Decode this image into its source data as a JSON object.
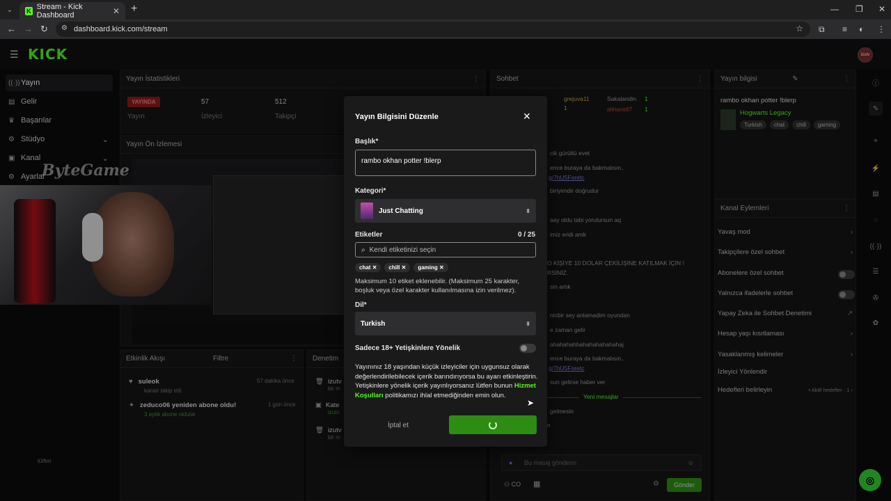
{
  "browser": {
    "tab_title": "Stream - Kick Dashboard",
    "url": "dashboard.kick.com/stream",
    "tab_close": "✕",
    "new_tab": "+"
  },
  "app": {
    "logo": "KICK",
    "avatar": "izutv"
  },
  "sidebar": {
    "items": [
      {
        "label": "Yayın",
        "icon": "broadcast-icon"
      },
      {
        "label": "Gelir",
        "icon": "wallet-icon"
      },
      {
        "label": "Başarılar",
        "icon": "trophy-icon"
      },
      {
        "label": "Stüdyo",
        "icon": "studio-icon"
      },
      {
        "label": "Kanal",
        "icon": "channel-icon"
      },
      {
        "label": "Ayarlar",
        "icon": "gear-icon"
      }
    ]
  },
  "stats": {
    "title": "Yayın İstatistikleri",
    "live_badge": "YAYINDA",
    "live_sub": "Yayın",
    "viewers_value": "57",
    "viewers_label": "İzleyici",
    "followers_value": "512",
    "followers_label": "Takipçi"
  },
  "preview": {
    "title": "Yayın Ön İzlemesi"
  },
  "watermark": "ByteGame",
  "activity": {
    "title": "Etkinlik Akışı",
    "filter": "Filtre",
    "items": [
      {
        "name": "suleok",
        "desc": "kanalı takip etti",
        "time": "57 dakika önce"
      },
      {
        "name": "zeduco06 yeniden abone oldu!",
        "desc": "3 aylık abone oldular",
        "time": "1 gün önce"
      }
    ]
  },
  "moderation": {
    "title": "Denetim",
    "items": [
      "izutv",
      "Kate",
      "izutv"
    ],
    "subs": [
      "bir m",
      "izutv",
      "bir m"
    ]
  },
  "chat": {
    "title": "Sohbet",
    "lines": [
      "cik gürültü evet",
      "ence buraya da bakmalısın..",
      "g/7hU5Foretc",
      "biriyimdir doğrudur",
      "aay oldu tabi yorulursun aq",
      "imiz eridi amk",
      "O KİŞİYE 10 DOLAR ÇEKİLİŞİNE KATILMAK İÇİN !",
      "RSİNİZ.",
      "sin artık",
      "nicbir sey anlamadim oyundan",
      "e zaman gelir",
      "ahahahahhahahahahahahaj",
      "ence buraya da bakmalısın..",
      "g/7hU5Foretc",
      "sun gelirse haber ver"
    ],
    "users": [
      "grejuva11",
      "Sakalandin",
      "alihans97"
    ],
    "counts": [
      "1",
      "1",
      "1"
    ],
    "new_messages": "Yeni mesajlar",
    "after_new": [
      "gelmesin",
      "n"
    ],
    "input_placeholder": "Bu masaj gönderin",
    "send": "Gönder",
    "bottom_left": "CO",
    "footer_note": "lütfen"
  },
  "stream_info": {
    "title": "Yayın bilgisi",
    "stream_title": "rambo okhan potter !blerp",
    "category": "Hogwarts Legacy",
    "tags": [
      "Turkish",
      "chat",
      "chill",
      "gaming"
    ]
  },
  "channel_actions": {
    "title": "Kanal Eylemleri",
    "rows": [
      {
        "label": "Yavaş mod",
        "right": "›"
      },
      {
        "label": "Takipçilere özel sohbet",
        "right": "›"
      },
      {
        "label": "Abonelere özel sohbet",
        "right": "toggle"
      },
      {
        "label": "Yalnızca ifadelerle sohbet",
        "right": "toggle"
      },
      {
        "label": "Yapay Zeka ile Sohbet Denetimi",
        "right": "↗"
      },
      {
        "label": "Hesap yaşı kısıtlaması",
        "right": "›"
      },
      {
        "label": "Yasaklanmış kelimeler",
        "right": "›"
      },
      {
        "label": "İzleyici Yönlendir",
        "right": ""
      },
      {
        "label": "Hedefleri belirleyin",
        "right": "• Aktif hedefler · 1 ›"
      }
    ]
  },
  "modal": {
    "title": "Yayın Bilgisini Düzenle",
    "close": "✕",
    "title_label": "Başlık*",
    "title_value": "rambo okhan potter !blerp",
    "category_label": "Kategori*",
    "category_value": "Just Chatting",
    "tags_label": "Etiketler",
    "tags_count": "0 / 25",
    "tags_placeholder": "Kendi etiketinizi seçin",
    "tags": [
      "chat",
      "chill",
      "gaming"
    ],
    "tags_help": "Maksimum 10 etiket eklenebilir. (Maksimum 25 karakter, boşluk veya özel karakter kullanılmasına izin verilmez).",
    "lang_label": "Dil*",
    "lang_value": "Turkish",
    "adult_label": "Sadece 18+ Yetişkinlere Yönelik",
    "adult_on": false,
    "warn_text_1": "Yayınınız 18 yaşından küçük izleyiciler için uygunsuz olarak değerlendirilebilecek içerik barındırıyorsa bu ayarı etkinleştirin. Yetişkinlere yönelik içerik yayınlıyorsanız lütfen bunun ",
    "warn_link": "Hizmet Koşulları",
    "warn_text_2": " politikamızı ihlal etmediğinden emin olun.",
    "cancel": "İptal et",
    "accent": "#53fc18"
  }
}
